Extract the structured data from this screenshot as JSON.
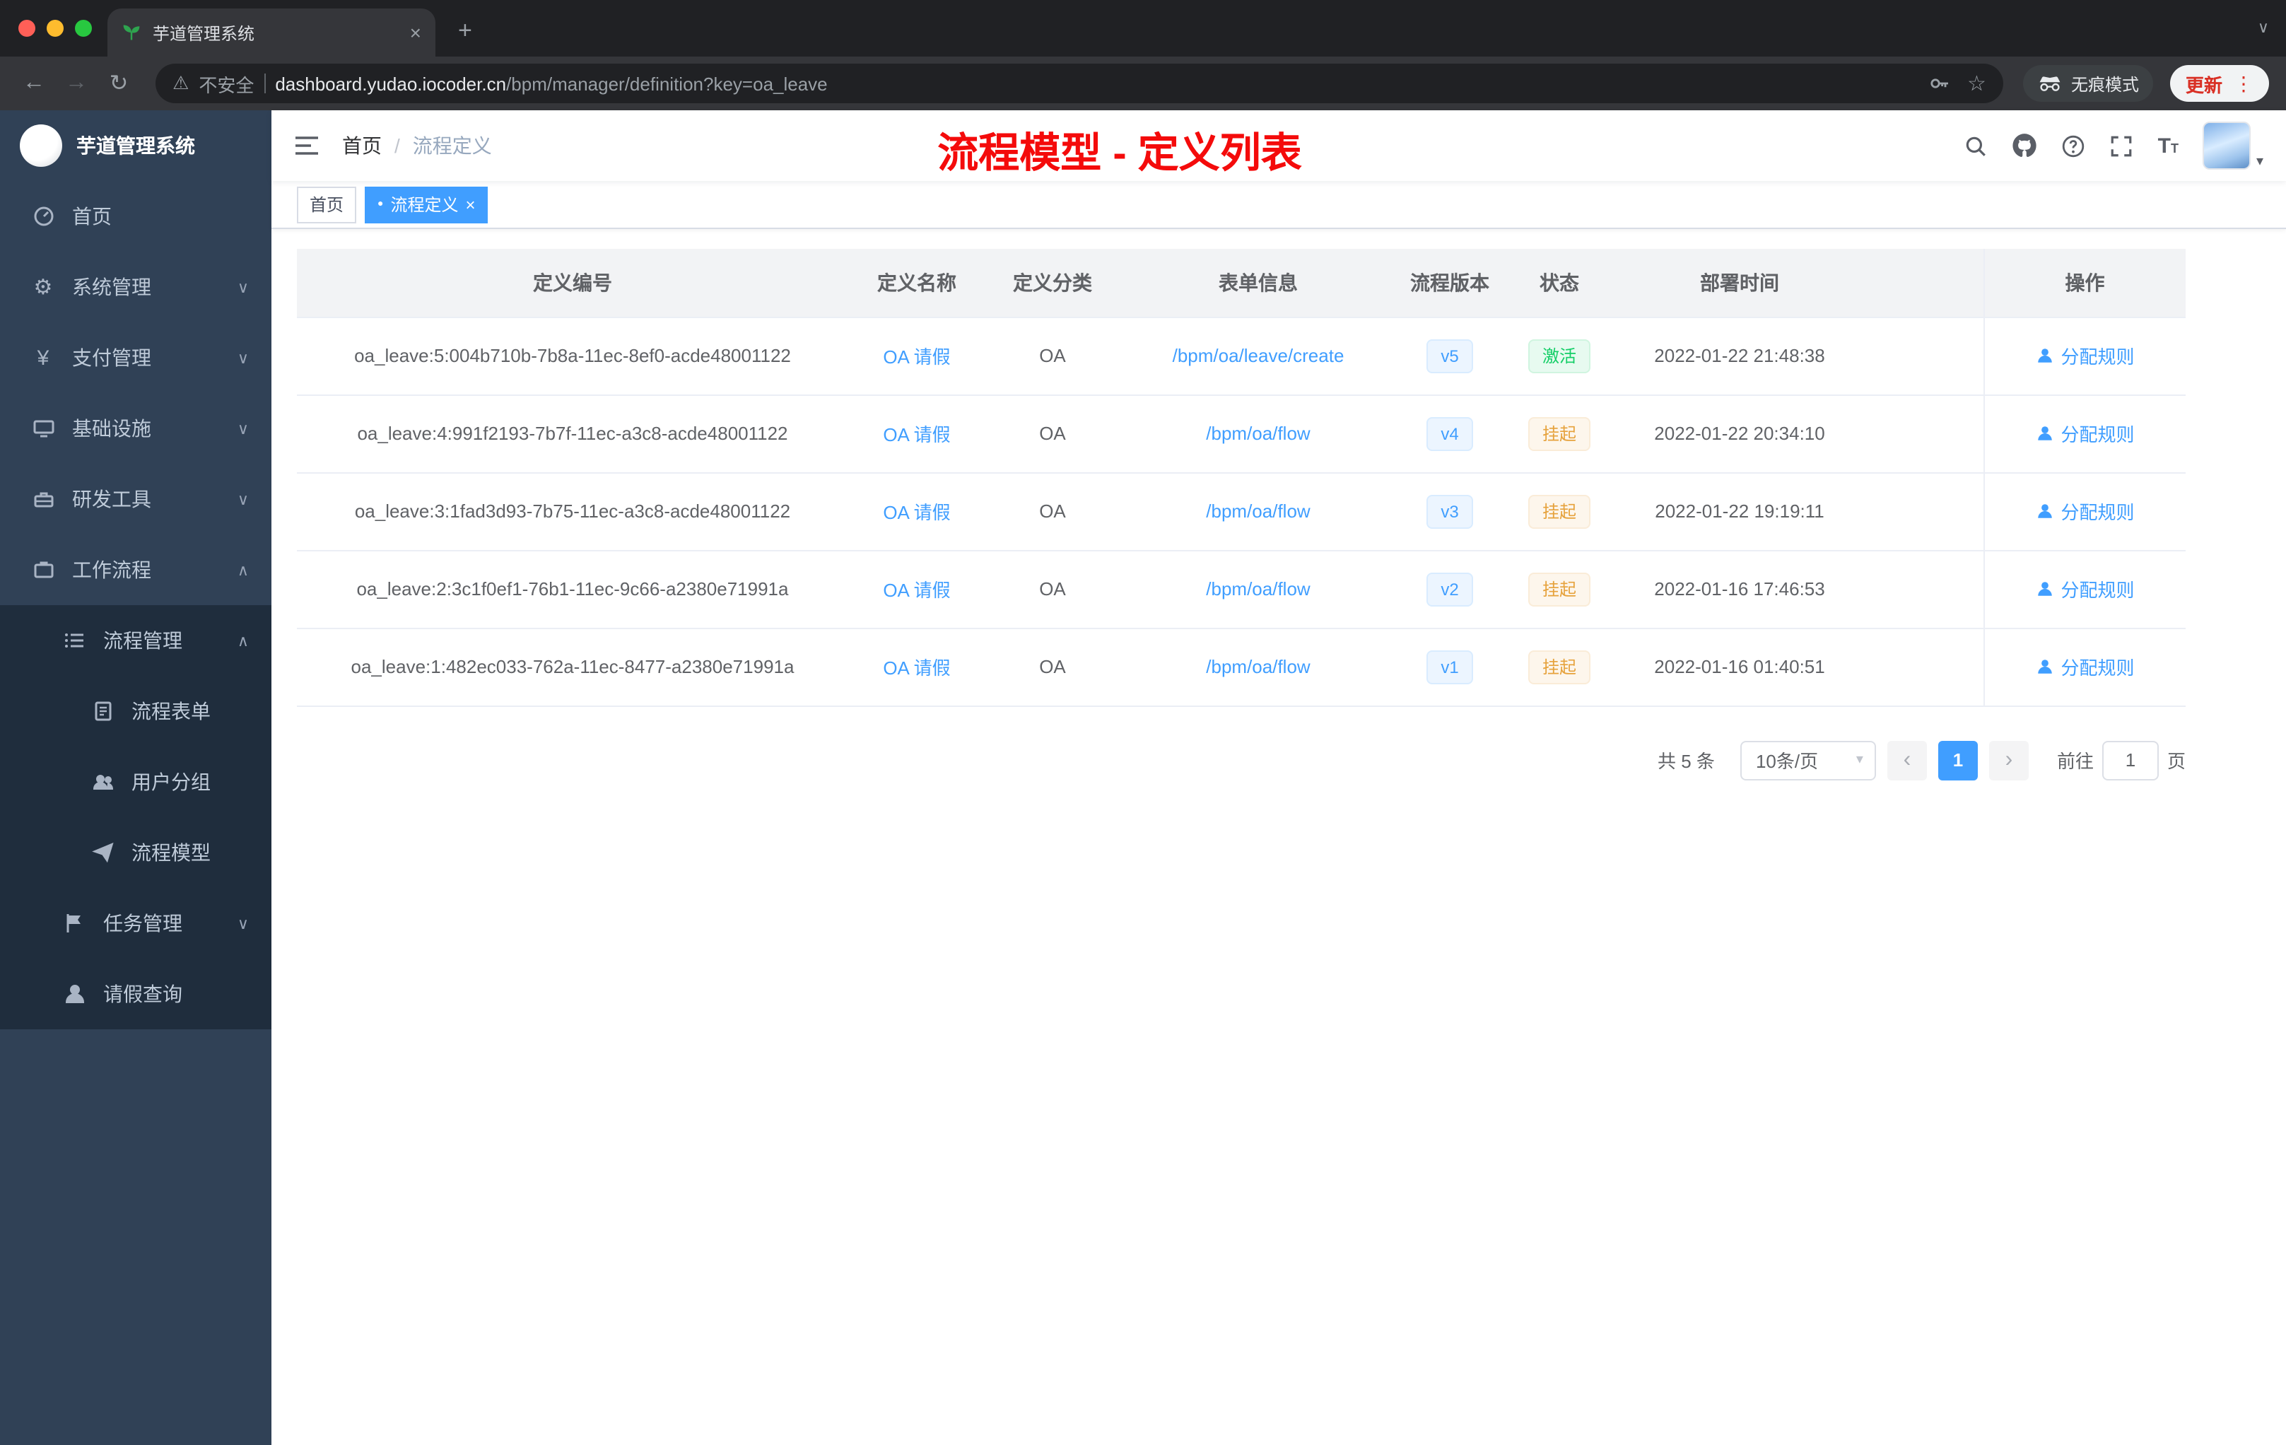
{
  "colors": {
    "primary": "#409eff",
    "success": "#13ce66",
    "warning": "#e6a23c",
    "annotation_red": "#f40b0b",
    "sidebar_bg": "#304156",
    "sidebar_submenu_bg": "#1f2d3d"
  },
  "browser": {
    "tab_title": "芋道管理系统",
    "security_label": "不安全",
    "url_host": "dashboard.yudao.iocoder.cn",
    "url_path": "/bpm/manager/definition?key=oa_leave",
    "incognito_label": "无痕模式",
    "update_label": "更新"
  },
  "icons": {
    "tab_close": "×",
    "new_tab": "+",
    "tab_overflow": "∨",
    "back": "←",
    "forward": "→",
    "reload": "↻",
    "warning": "⚠",
    "star": "☆",
    "more": "⋮",
    "caret_down": "▾",
    "chevron_down": "∨",
    "chevron_up": "∧",
    "yen": "¥",
    "gear": "⚙",
    "page_prev": "‹",
    "page_next": "›",
    "tag_close": "×",
    "active_dot": "●",
    "font_large": "T",
    "font_small": "T"
  },
  "sidebar": {
    "logo_title": "芋道管理系统",
    "home": "首页",
    "system": "系统管理",
    "payment": "支付管理",
    "infrastructure": "基础设施",
    "devtools": "研发工具",
    "workflow": "工作流程",
    "process_mgmt": "流程管理",
    "process_form": "流程表单",
    "user_group": "用户分组",
    "process_model": "流程模型",
    "task_mgmt": "任务管理",
    "leave_query": "请假查询"
  },
  "header": {
    "breadcrumb_home": "首页",
    "breadcrumb_sep": "/",
    "breadcrumb_current": "流程定义",
    "annotation": "流程模型 - 定义列表"
  },
  "tags": {
    "home": "首页",
    "active": "流程定义"
  },
  "table": {
    "columns": [
      "定义编号",
      "定义名称",
      "定义分类",
      "表单信息",
      "流程版本",
      "状态",
      "部署时间",
      "操作"
    ],
    "rows": [
      {
        "id": "oa_leave:5:004b710b-7b8a-11ec-8ef0-acde48001122",
        "name": "OA 请假",
        "category": "OA",
        "form": "/bpm/oa/leave/create",
        "version": "v5",
        "status": "激活",
        "time": "2022-01-22 21:48:38",
        "action": "分配规则"
      },
      {
        "id": "oa_leave:4:991f2193-7b7f-11ec-a3c8-acde48001122",
        "name": "OA 请假",
        "category": "OA",
        "form": "/bpm/oa/flow",
        "version": "v4",
        "status": "挂起",
        "time": "2022-01-22 20:34:10",
        "action": "分配规则"
      },
      {
        "id": "oa_leave:3:1fad3d93-7b75-11ec-a3c8-acde48001122",
        "name": "OA 请假",
        "category": "OA",
        "form": "/bpm/oa/flow",
        "version": "v3",
        "status": "挂起",
        "time": "2022-01-22 19:19:11",
        "action": "分配规则"
      },
      {
        "id": "oa_leave:2:3c1f0ef1-76b1-11ec-9c66-a2380e71991a",
        "name": "OA 请假",
        "category": "OA",
        "form": "/bpm/oa/flow",
        "version": "v2",
        "status": "挂起",
        "time": "2022-01-16 17:46:53",
        "action": "分配规则"
      },
      {
        "id": "oa_leave:1:482ec033-762a-11ec-8477-a2380e71991a",
        "name": "OA 请假",
        "category": "OA",
        "form": "/bpm/oa/flow",
        "version": "v1",
        "status": "挂起",
        "time": "2022-01-16 01:40:51",
        "action": "分配规则"
      }
    ]
  },
  "pagination": {
    "total": "共 5 条",
    "page_size": "10条/页",
    "page": "1",
    "goto_label": "前往",
    "goto_value": "1",
    "unit_label": "页"
  }
}
